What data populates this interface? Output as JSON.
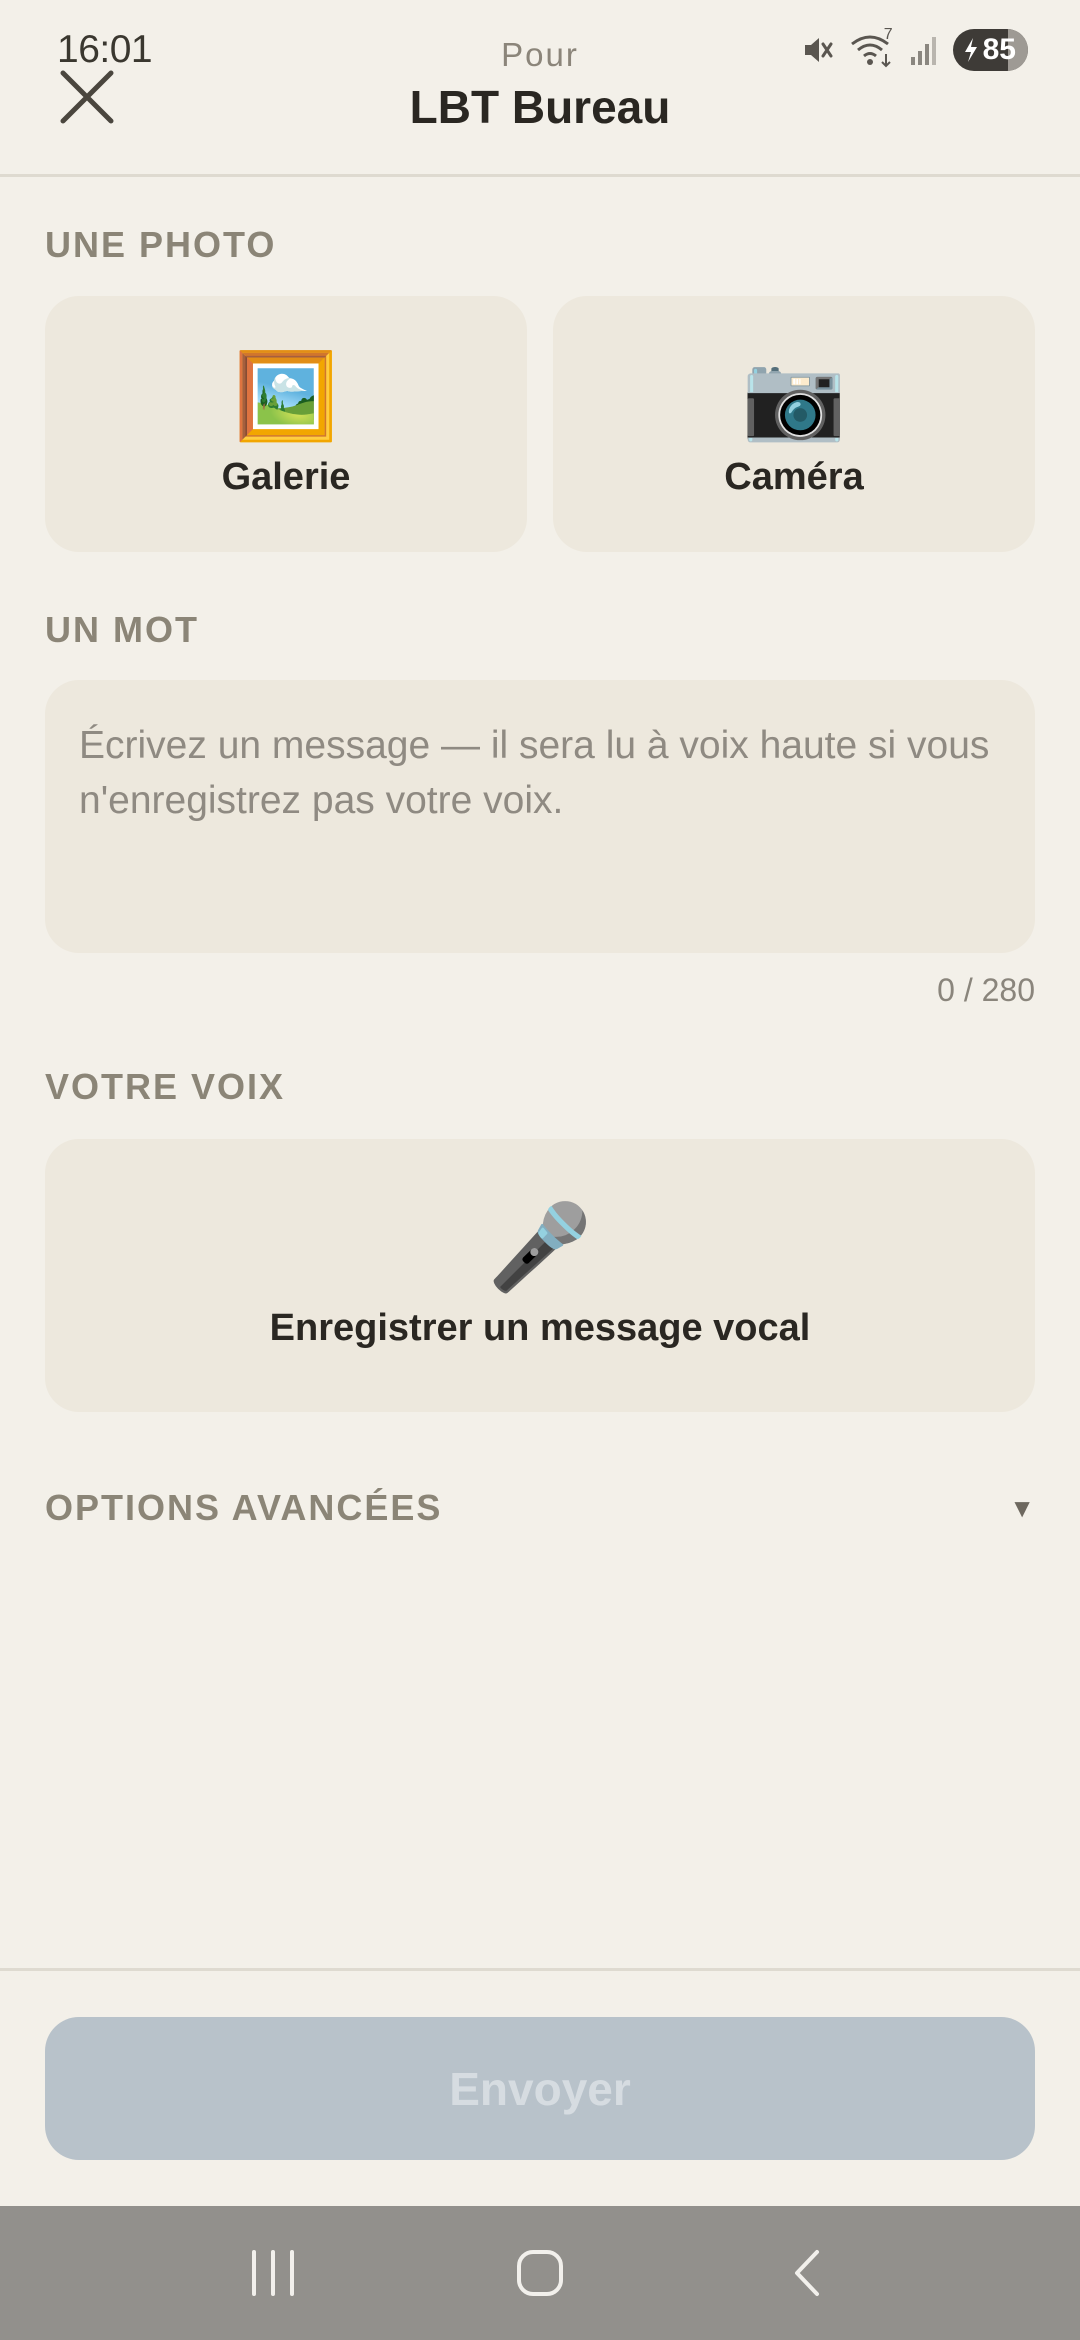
{
  "status_bar": {
    "time": "16:01",
    "wifi_badge": "7",
    "battery_level": "85",
    "icons": [
      "mute-icon",
      "wifi-icon",
      "signal-icon",
      "battery-icon"
    ]
  },
  "header": {
    "subtitle": "Pour",
    "title": "LBT Bureau",
    "close_icon": "close-icon"
  },
  "photo_section": {
    "label": "UNE PHOTO",
    "gallery": {
      "icon": "🖼️",
      "label": "Galerie"
    },
    "camera": {
      "icon": "📷",
      "label": "Caméra"
    }
  },
  "word_section": {
    "label": "UN MOT",
    "placeholder": "Écrivez un message — il sera lu à voix haute si vous n'enregistrez pas votre voix.",
    "value": "",
    "counter": "0 / 280"
  },
  "voice_section": {
    "label": "VOTRE VOIX",
    "icon": "🎤",
    "record_label": "Enregistrer un message vocal"
  },
  "advanced": {
    "label": "OPTIONS AVANCÉES",
    "arrow": "▼"
  },
  "send": {
    "label": "Envoyer",
    "enabled": false
  },
  "colors": {
    "background": "#f3f0e9",
    "card": "#ede8dd",
    "section_label": "#8b8577",
    "send_disabled": "#b8c2ca"
  }
}
